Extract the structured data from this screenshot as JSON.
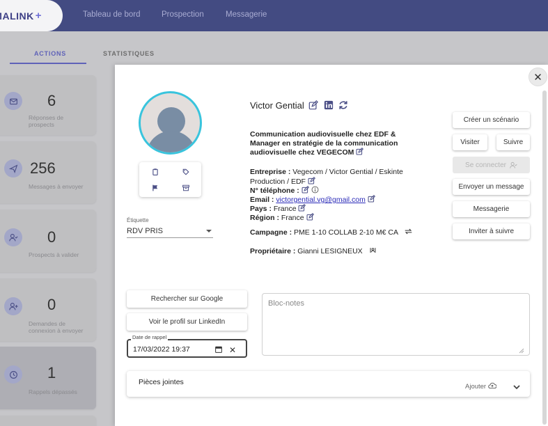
{
  "app": {
    "logo": "MALINK",
    "logo_plus": "+"
  },
  "nav": {
    "items": [
      "Tableau de bord",
      "Prospection",
      "Messagerie"
    ]
  },
  "tabs": {
    "actions": "ACTIONS",
    "statistiques": "STATISTIQUES"
  },
  "cards": [
    {
      "value": "6",
      "label": "Réponses de prospects",
      "icon": "envelope-icon"
    },
    {
      "value": "256",
      "label": "Messages à envoyer",
      "icon": "paper-plane-icon"
    },
    {
      "value": "0",
      "label": "Prospects à valider",
      "icon": "user-check-icon"
    },
    {
      "value": "0",
      "label": "Demandes de connexion à envoyer",
      "icon": "user-plus-icon"
    },
    {
      "value": "1",
      "label": "Rappels dépassés",
      "icon": "clock-icon"
    }
  ],
  "modal": {
    "close": "✕",
    "etiquette_label": "Étiquette",
    "etiquette_value": "RDV PRIS",
    "name": "Victor Gential",
    "headline": "Communication audiovisuelle chez EDF & Manager en stratégie de la communication audiovisuelle chez VEGECOM",
    "entreprise_label": "Entreprise :",
    "entreprise_value": "Vegecom / Victor Gential / Eskinte Production / EDF",
    "telephone_label": "N° téléphone :",
    "email_label": "Email :",
    "email_value": "victorgential.vg@gmail.com",
    "pays_label": "Pays :",
    "pays_value": "France",
    "region_label": "Région :",
    "region_value": "France",
    "campagne_label": "Campagne :",
    "campagne_value": "PME 1-10 COLLAB 2-10 M€ CA",
    "proprietaire_label": "Propriétaire :",
    "proprietaire_value": "Gianni LESIGNEUX",
    "buttons": {
      "creer_scenario": "Créer un scénario",
      "visiter": "Visiter",
      "suivre": "Suivre",
      "se_connecter": "Se connecter",
      "envoyer_message": "Envoyer un message",
      "messagerie": "Messagerie",
      "inviter": "Inviter à suivre",
      "google": "Rechercher sur Google",
      "linkedin": "Voir le profil sur LinkedIn"
    },
    "date_label": "Date de rappel",
    "date_value": "17/03/2022 19:37",
    "notes_placeholder": "Bloc-notes",
    "pieces_jointes": "Pièces jointes",
    "ajouter": "Ajouter"
  },
  "colors": {
    "topbar": "#434b82",
    "accent": "#5f62b8",
    "avatar_border": "#39c4dd",
    "link": "#2a2ab8"
  }
}
